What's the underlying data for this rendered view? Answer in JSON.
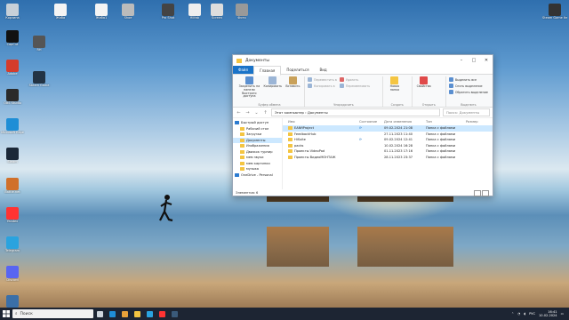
{
  "desktop": {
    "icons": [
      {
        "label": "Корзина",
        "color": "#c8d0d8"
      },
      {
        "label": "CapCut",
        "color": "#111111"
      },
      {
        "label": "Adobe",
        "color": "#d43c2c"
      },
      {
        "label": "OBS Studio",
        "color": "#2a2a2a"
      },
      {
        "label": "Microsoft Edge",
        "color": "#1f8ed6"
      },
      {
        "label": "Steam",
        "color": "#1b2838"
      },
      {
        "label": "Battle.net",
        "color": "#d0702a"
      },
      {
        "label": "Yandex",
        "color": "#ff3333"
      },
      {
        "label": "Telegram",
        "color": "#2aa3df"
      },
      {
        "label": "Discord",
        "color": "#5865f2"
      },
      {
        "label": "EvilTools",
        "color": "#3a6fa8"
      },
      {
        "label": "Жаба",
        "color": "#f4f4f4"
      },
      {
        "label": "Жаба1",
        "color": "#f4f4f4"
      },
      {
        "label": "Shoe",
        "color": "#bbbbbb"
      },
      {
        "label": "Pro Shot",
        "color": "#444444"
      },
      {
        "label": "fillfab",
        "color": "#eeeeee"
      },
      {
        "label": "Screen",
        "color": "#dddddd"
      },
      {
        "label": "Фото",
        "color": "#999999"
      },
      {
        "label": "RH",
        "color": "#555555"
      },
      {
        "label": "Steam Game",
        "color": "#223344"
      }
    ],
    "right_icon": {
      "label": "Steam Game Item"
    }
  },
  "explorer": {
    "title": "Документы",
    "tabs": [
      "Файл",
      "Главная",
      "Поделиться",
      "Вид"
    ],
    "ribbon": {
      "clipboard": {
        "name": "Буфер обмена",
        "pin": "Закрепить на панели быстрого доступа",
        "copy": "Копировать",
        "paste": "Вставить"
      },
      "organize": {
        "name": "Упорядочить",
        "move": "Переместить в",
        "copyto": "Копировать в",
        "delete": "Удалить",
        "rename": "Переименовать"
      },
      "create": {
        "name": "Создать",
        "newfolder": "Новая папка"
      },
      "open": {
        "name": "Открыть",
        "properties": "Свойства"
      },
      "select": {
        "name": "Выделить",
        "all": "Выделить все",
        "none": "Снять выделение",
        "invert": "Обратить выделение"
      }
    },
    "address": "Этот компьютер › Документы",
    "search_placeholder": "Поиск: Документы",
    "nav": [
      "Быстрый доступ",
      "Рабочий стол",
      "Загрузки",
      "Документы",
      "Изображения",
      "Движок турнир",
      "мем звуки",
      "мем картинки",
      "музыка",
      "OneDrive - Personal"
    ],
    "columns": {
      "name": "Имя",
      "status": "Состояние",
      "date": "Дата изменения",
      "type": "Тип",
      "size": "Размер"
    },
    "rows": [
      {
        "name": "EANfiProject",
        "status": "⟳",
        "date": "09.02.2024 21:08",
        "type": "Папка с файлами"
      },
      {
        "name": "FeedbackHub",
        "status": "",
        "date": "27.11.2023 11:40",
        "type": "Папка с файлами"
      },
      {
        "name": "HiSuite",
        "status": "⟳",
        "date": "09.02.2024 12:41",
        "type": "Папка с файлами"
      },
      {
        "name": "packs",
        "status": "",
        "date": "10.02.2024 16:28",
        "type": "Папка с файлами"
      },
      {
        "name": "Проекты VideoPad",
        "status": "",
        "date": "01.11.2023 17:16",
        "type": "Папка с файлами"
      },
      {
        "name": "Проекты ВидеоМОНТАЖ",
        "status": "",
        "date": "28.11.2023 23:37",
        "type": "Папка с файлами"
      }
    ],
    "status": "Элементов: 6"
  },
  "taskbar": {
    "search_placeholder": "Поиск",
    "apps": [
      {
        "name": "task-view",
        "color": "#cfd6de"
      },
      {
        "name": "edge",
        "color": "#1f8ed6"
      },
      {
        "name": "chrome",
        "color": "#e8a23a"
      },
      {
        "name": "explorer",
        "color": "#f4c542"
      },
      {
        "name": "telegram",
        "color": "#2aa3df"
      },
      {
        "name": "yandex",
        "color": "#ff3333"
      },
      {
        "name": "steam",
        "color": "#3a5a7a"
      }
    ],
    "lang": "РУС",
    "time": "16:41",
    "date": "10.02.2024"
  }
}
